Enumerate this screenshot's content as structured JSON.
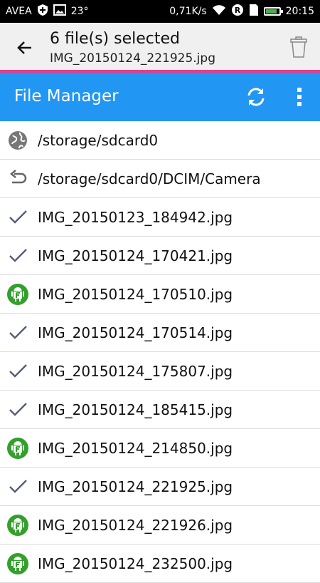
{
  "status_bar": {
    "carrier": "AVEA",
    "temperature": "23°",
    "network_speed": "0,71K/s",
    "time": "20:15",
    "icons": [
      "shield-icon",
      "image-icon",
      "wifi-icon",
      "r-icon",
      "sim-icon",
      "battery-icon"
    ]
  },
  "selection": {
    "title": "6 file(s) selected",
    "subtitle": "IMG_20150124_221925.jpg"
  },
  "app_bar": {
    "title": "File Manager",
    "color": "#2196f3"
  },
  "list": {
    "rows": [
      {
        "icon": "globe-icon",
        "label": "/storage/sdcard0"
      },
      {
        "icon": "back-arrow-icon",
        "label": "/storage/sdcard0/DCIM/Camera"
      },
      {
        "icon": "check-icon",
        "label": "IMG_20150123_184942.jpg"
      },
      {
        "icon": "check-icon",
        "label": "IMG_20150124_170421.jpg"
      },
      {
        "icon": "android-file-icon",
        "label": "IMG_20150124_170510.jpg"
      },
      {
        "icon": "check-icon",
        "label": "IMG_20150124_170514.jpg"
      },
      {
        "icon": "check-icon",
        "label": "IMG_20150124_175807.jpg"
      },
      {
        "icon": "check-icon",
        "label": "IMG_20150124_185415.jpg"
      },
      {
        "icon": "android-file-icon",
        "label": "IMG_20150124_214850.jpg"
      },
      {
        "icon": "check-icon",
        "label": "IMG_20150124_221925.jpg"
      },
      {
        "icon": "android-file-icon",
        "label": "IMG_20150124_221926.jpg"
      },
      {
        "icon": "android-file-icon",
        "label": "IMG_20150124_232500.jpg"
      }
    ]
  }
}
